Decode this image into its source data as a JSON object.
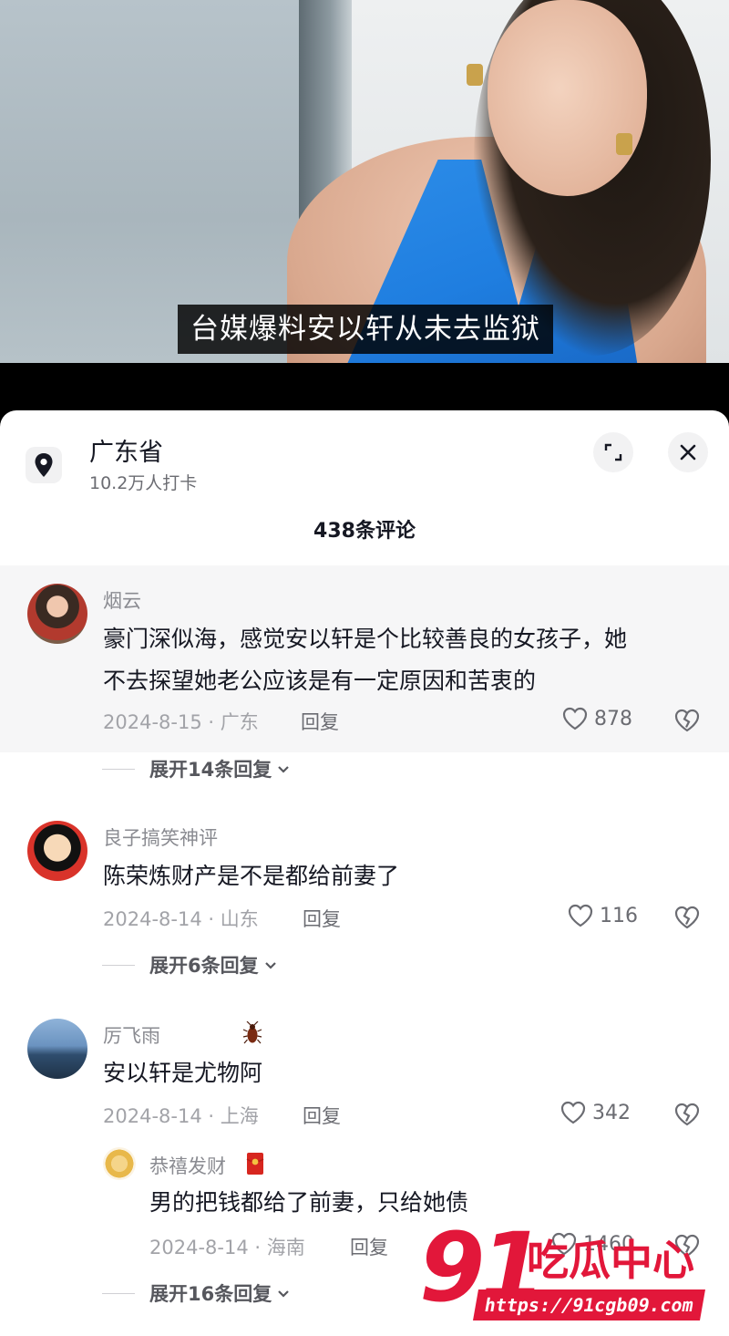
{
  "video": {
    "subtitle": "台媒爆料安以轩从未去监狱"
  },
  "location": {
    "title": "广东省",
    "checkins": "10.2万人打卡",
    "icon": "location-pin-icon"
  },
  "header": {
    "comment_count": "438条评论",
    "expand_icon": "expand-icon",
    "close_icon": "close-icon"
  },
  "comments": [
    {
      "user": "烟云",
      "text_line1": "豪门深似海，感觉安以轩是个比较善良的女孩子，她",
      "text_line2": "不去探望她老公应该是有一定原因和苦衷的",
      "date_location": "2024-8-15 · 广东",
      "reply_label": "回复",
      "likes": "878",
      "expand": "展开14条回复"
    },
    {
      "user": "良子搞笑神评",
      "text_line1": "陈荣炼财产是不是都给前妻了",
      "date_location": "2024-8-14 · 山东",
      "reply_label": "回复",
      "likes": "116",
      "expand": "展开6条回复"
    },
    {
      "user": "厉飞雨",
      "text_line1": "安以轩是尤物阿",
      "date_location": "2024-8-14 · 上海",
      "reply_label": "回复",
      "likes": "342",
      "reply": {
        "user": "恭禧发财",
        "text": "男的把钱都给了前妻，只给她债",
        "date_location": "2024-8-14 · 海南",
        "reply_label": "回复",
        "likes": "1460"
      },
      "expand": "展开16条回复"
    }
  ],
  "watermark": {
    "number": "91",
    "name": "吃瓜中心",
    "url": "https://91cgb09.com"
  },
  "colors": {
    "accent_red": "#e2173a",
    "dress_blue": "#1f7ee0",
    "text_primary": "#161823",
    "text_secondary": "#8a8b91"
  }
}
